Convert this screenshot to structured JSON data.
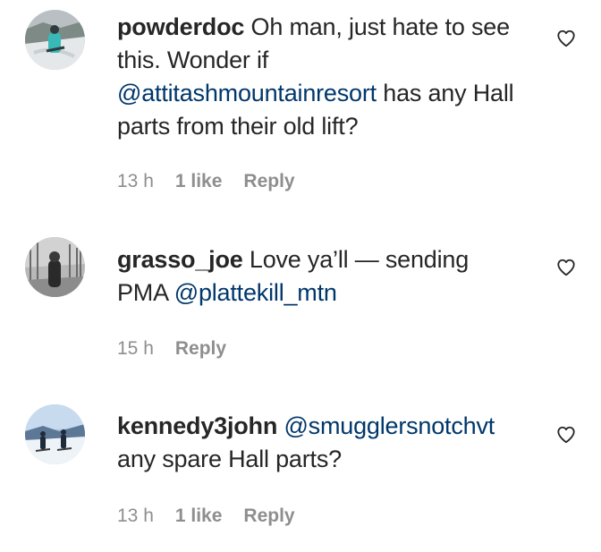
{
  "comments": [
    {
      "username": "powderdoc",
      "text_before": " Oh man, just hate to see this. Wonder if ",
      "mention": "@attitashmountainresort",
      "text_after": " has any Hall parts from their old lift?",
      "time": "13 h",
      "likes": "1 like",
      "reply": "Reply",
      "avatar_icon": "profile-photo-snow-person"
    },
    {
      "username": "grasso_joe",
      "text_before": " Love ya’ll — sending PMA ",
      "mention": "@plattekill_mtn",
      "text_after": "",
      "time": "15 h",
      "likes": "",
      "reply": "Reply",
      "avatar_icon": "profile-photo-person-trees"
    },
    {
      "username": "kennedy3john",
      "text_before": " ",
      "mention": "@smugglersnotchvt",
      "text_after": " any spare Hall parts?",
      "time": "13 h",
      "likes": "1 like",
      "reply": "Reply",
      "avatar_icon": "profile-photo-skiers"
    }
  ],
  "icons": {
    "like": "heart-outline-icon"
  },
  "colors": {
    "text": "#262626",
    "mention": "#00376b",
    "meta": "#8e8e8e"
  }
}
